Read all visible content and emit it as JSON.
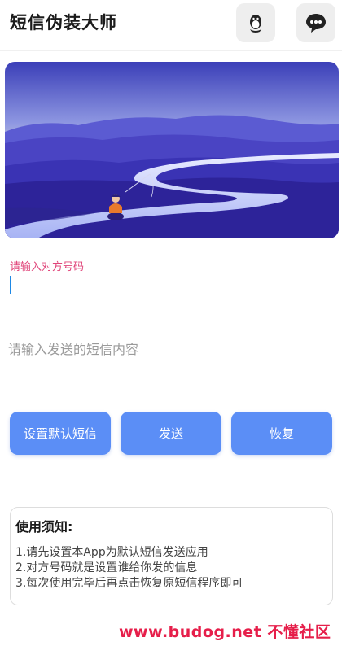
{
  "header": {
    "title": "短信伪装大师",
    "qq_icon": "qq-penguin-icon",
    "chat_icon": "chat-bubble-icon"
  },
  "form": {
    "phone_label": "请输入对方号码",
    "phone_value": "",
    "message_placeholder": "请输入发送的短信内容",
    "message_value": ""
  },
  "buttons": {
    "set_default_label": "设置默认短信",
    "send_label": "发送",
    "restore_label": "恢复"
  },
  "notice": {
    "title": "使用须知:",
    "lines": [
      "1.请先设置本App为默认短信发送应用",
      "2.对方号码就是设置谁给你发的信息",
      "3.每次使用完毕后再点击恢复原短信程序即可"
    ]
  },
  "watermark": "www.budog.net 不懂社区",
  "colors": {
    "accent": "#5b8ef6",
    "label_pink": "#e0457a",
    "watermark_red": "#e61e4a"
  }
}
